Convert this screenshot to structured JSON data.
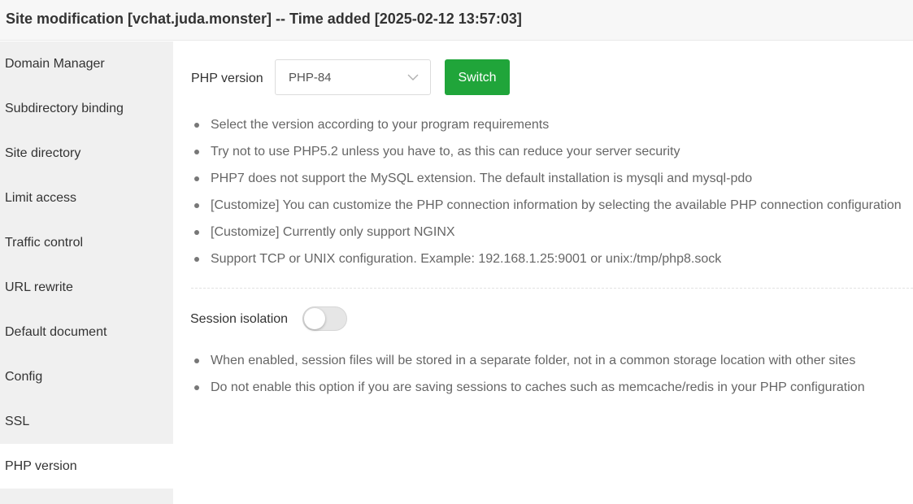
{
  "window": {
    "title": "Site modification [vchat.juda.monster] -- Time added [2025-02-12 13:57:03]"
  },
  "sidebar": {
    "items": [
      {
        "label": "Domain Manager"
      },
      {
        "label": "Subdirectory binding"
      },
      {
        "label": "Site directory"
      },
      {
        "label": "Limit access"
      },
      {
        "label": "Traffic control"
      },
      {
        "label": "URL rewrite"
      },
      {
        "label": "Default document"
      },
      {
        "label": "Config"
      },
      {
        "label": "SSL"
      },
      {
        "label": "PHP version"
      }
    ],
    "active": "PHP version"
  },
  "php": {
    "label": "PHP version",
    "selected": "PHP-84",
    "switch_label": "Switch",
    "tips": [
      "Select the version according to your program requirements",
      "Try not to use PHP5.2 unless you have to, as this can reduce your server security",
      "PHP7 does not support the MySQL extension. The default installation is mysqli and mysql-pdo",
      "[Customize] You can customize the PHP connection information by selecting the available PHP connection configuration",
      "[Customize] Currently only support NGINX",
      "Support TCP or UNIX configuration. Example: 192.168.1.25:9001 or unix:/tmp/php8.sock"
    ]
  },
  "session": {
    "label": "Session isolation",
    "enabled": false,
    "tips": [
      "When enabled, session files will be stored in a separate folder, not in a common storage location with other sites",
      "Do not enable this option if you are saving sessions to caches such as memcache/redis in your PHP configuration"
    ]
  },
  "colors": {
    "accent": "#20a53a",
    "sidebar_bg": "#f0f0f0",
    "titlebar_bg": "#f7f7f7"
  },
  "icons": {
    "select_chevron": "chevron-down-icon"
  }
}
